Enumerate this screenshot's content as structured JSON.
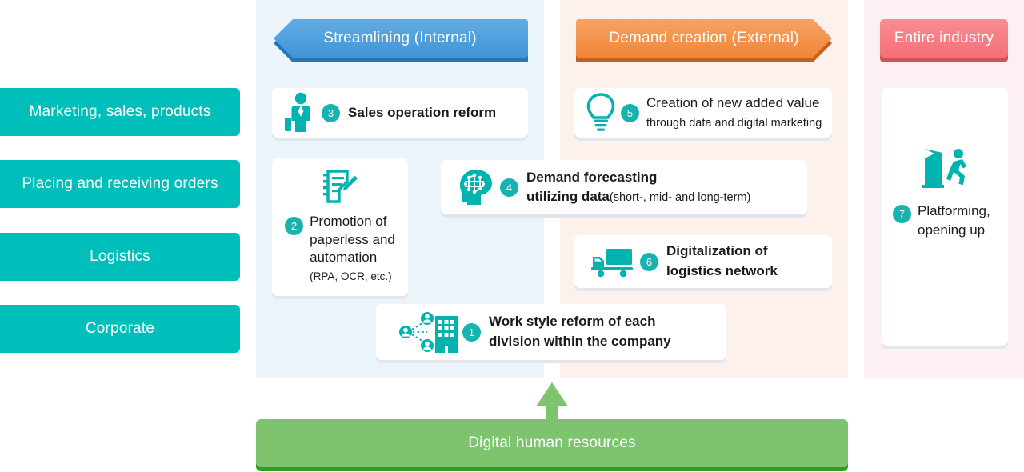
{
  "categories": [
    {
      "id": "marketing",
      "label": "Marketing, sales, products"
    },
    {
      "id": "orders",
      "label": "Placing and receiving orders"
    },
    {
      "id": "logistics",
      "label": "Logistics"
    },
    {
      "id": "corporate",
      "label": "Corporate"
    }
  ],
  "banners": {
    "internal": {
      "label": "Streamlining (Internal)",
      "color": "#4a9fdd",
      "shadow": "#2378b5",
      "arrow": "left"
    },
    "external": {
      "label": "Demand creation (External)",
      "color": "#f4934c",
      "shadow": "#c4601c",
      "arrow": "right"
    },
    "industry": {
      "label": "Entire industry",
      "color": "#f87b82",
      "shadow": "#cf5258",
      "arrow": "none"
    }
  },
  "panels": {
    "internal_bg": "#ebf3fb",
    "external_bg": "#fdf1ec",
    "industry_bg": "#fcf0f2"
  },
  "cards": {
    "c1": {
      "number": "1",
      "icon": "people-building-network-icon",
      "line1": "Work style reform of each",
      "line2": "division within the company"
    },
    "c2": {
      "number": "2",
      "icon": "document-pencil-icon",
      "line1": "Promotion of",
      "line2": "paperless and",
      "line3": "automation",
      "note": "(RPA, OCR, etc.)"
    },
    "c3": {
      "number": "3",
      "icon": "businessperson-briefcase-icon",
      "line1": "Sales operation reform"
    },
    "c4": {
      "number": "4",
      "icon": "ai-brain-icon",
      "line1": "Demand forecasting",
      "line2": "utilizing data",
      "line2_note": "(short-, mid- and long-term)"
    },
    "c5": {
      "number": "5",
      "icon": "lightbulb-icon",
      "line1": "Creation of new added value",
      "line2": "through data and digital marketing"
    },
    "c6": {
      "number": "6",
      "icon": "truck-icon",
      "line1": "Digitalization of",
      "line2": "logistics network"
    },
    "c7": {
      "number": "7",
      "icon": "door-exit-person-icon",
      "line1": "Platforming,",
      "line2": "opening up"
    }
  },
  "footer": {
    "label": "Digital human resources",
    "color": "#7ec46f",
    "shadow": "#2e9e1f",
    "arrow_icon": "arrow-up-icon"
  },
  "accent": {
    "teal": "#00bfbb",
    "badge_teal": "#17b3b0",
    "icon_teal": "#00b3b0"
  }
}
